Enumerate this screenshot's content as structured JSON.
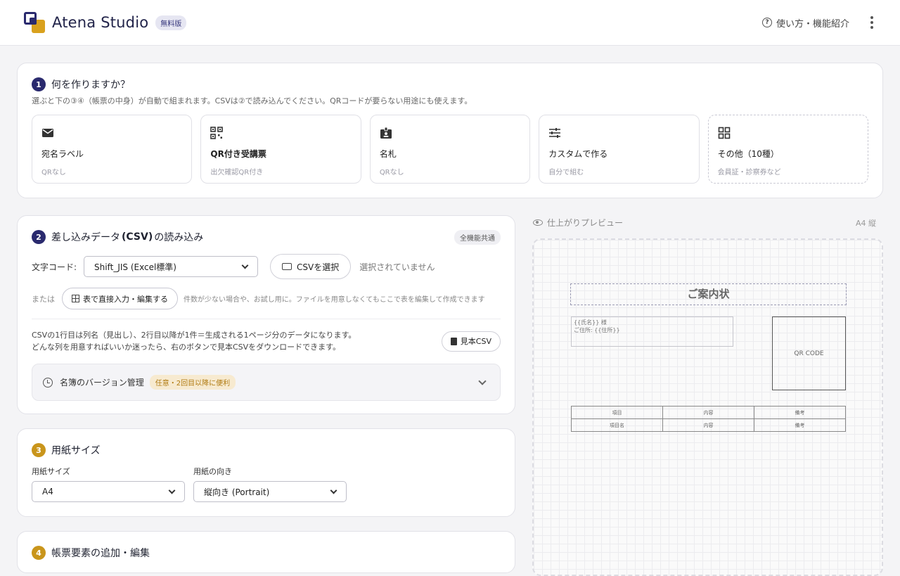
{
  "header": {
    "app_name": "Atena Studio",
    "badge": "無料版",
    "help_label": "使い方・機能紹介"
  },
  "step1": {
    "num": "1",
    "title": "何を作りますか？",
    "subtitle": "選ぶと下の③④（帳票の中身）が自動で組まれます。CSVは②で読み込んでください。QRコードが要らない用途にも使えます。",
    "options": [
      {
        "icon": "mail-icon",
        "label": "宛名ラベル",
        "sub": "QRなし"
      },
      {
        "icon": "qr-icon",
        "label": "QR付き受講票",
        "sub": "出欠確認QR付き"
      },
      {
        "icon": "badge-icon",
        "label": "名札",
        "sub": "QRなし"
      },
      {
        "icon": "sliders-icon",
        "label": "カスタムで作る",
        "sub": "自分で組む"
      },
      {
        "icon": "grid-icon",
        "label": "その他（10種）",
        "sub": "会員証・診察券など"
      }
    ]
  },
  "step2": {
    "num": "2",
    "title_pre": "差し込みデータ",
    "title_bold": "(CSV)",
    "title_post": "の読み込み",
    "tag": "全機能共通",
    "encoding_label": "文字コード:",
    "encoding_value": "Shift_JIS (Excel標準)",
    "choose_csv": "CSVを選択",
    "no_file": "選択されていません",
    "or": "または",
    "direct_edit": "表で直接入力・編集する",
    "direct_hint": "件数が少ない場合や、お試し用に。ファイルを用意しなくてもここで表を編集して作成できます",
    "csv_line1": "CSVの1行目は列名（見出し）、2行目以降が1件＝生成される1ページ分のデータになります。",
    "csv_line2": "どんな列を用意すればいいか迷ったら、右のボタンで見本CSVをダウンロードできます。",
    "sample_csv": "見本CSV",
    "version_title": "名簿のバージョン管理",
    "version_tag": "任意・2回目以降に便利"
  },
  "step3": {
    "num": "3",
    "title": "用紙サイズ",
    "size_label": "用紙サイズ",
    "size_value": "A4",
    "orient_label": "用紙の向き",
    "orient_value": "縦向き (Portrait)"
  },
  "step4": {
    "num": "4",
    "title": "帳票要素の追加・編集"
  },
  "preview": {
    "label": "仕上がりプレビュー",
    "size": "A4 縦",
    "doc_title": "ご案内状",
    "addr_line1": "{{氏名}} 様",
    "addr_line2": "ご住所: {{住所}}",
    "qr_text": "QR CODE",
    "table_header": [
      "項目",
      "内容",
      "備考"
    ],
    "table_row": [
      "項目名",
      "内容",
      "備考"
    ]
  },
  "colors": {
    "primary": "#2a2a6e",
    "accent": "#c9951b"
  }
}
